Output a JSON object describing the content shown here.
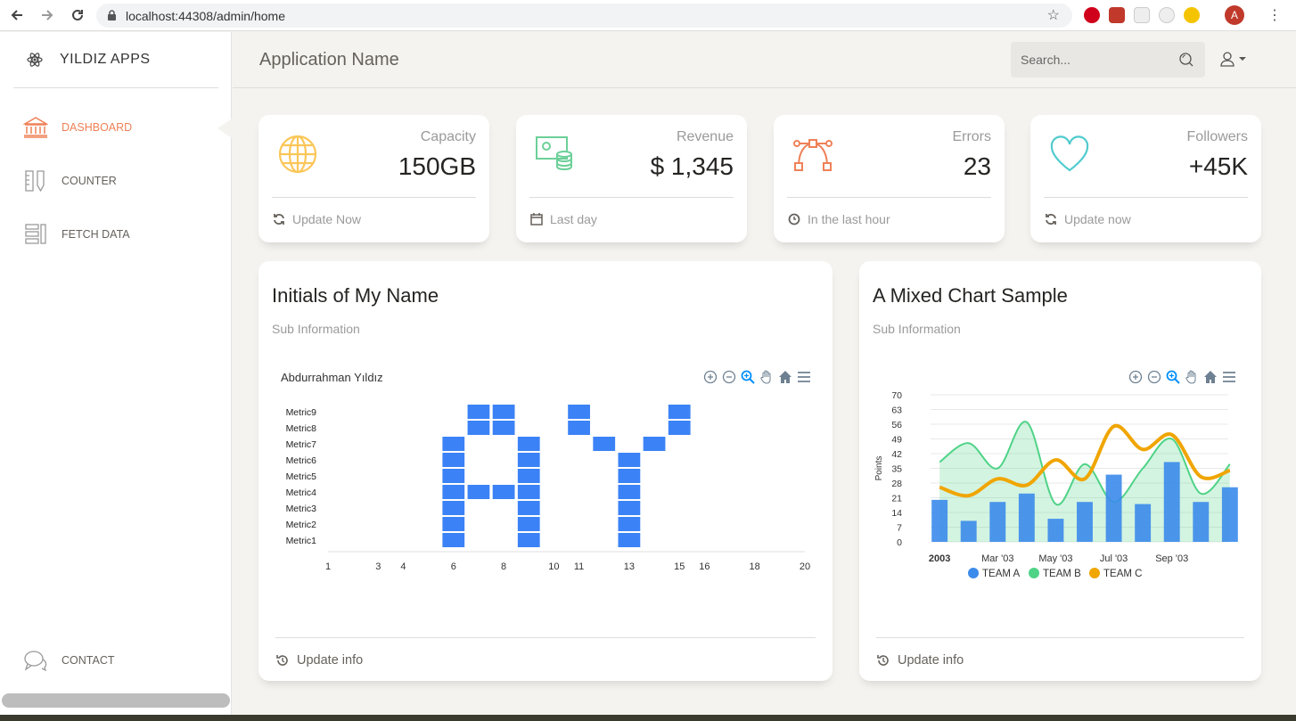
{
  "browser": {
    "url": "localhost:44308/admin/home",
    "avatar_letter": "A"
  },
  "sidebar": {
    "logo_text": "YILDIZ APPS",
    "items": [
      {
        "label": "DASHBOARD",
        "icon": "bank-icon",
        "active": true
      },
      {
        "label": "COUNTER",
        "icon": "ruler-pencil-icon",
        "active": false
      },
      {
        "label": "FETCH DATA",
        "icon": "layout-icon",
        "active": false
      },
      {
        "label": "CONTACT",
        "icon": "chat-icon",
        "active": false
      }
    ]
  },
  "topbar": {
    "app_name": "Application Name",
    "search_placeholder": "Search..."
  },
  "stats": [
    {
      "category": "Capacity",
      "value": "150GB",
      "footer": "Update Now",
      "icon": "globe-icon",
      "color": "#fbc658"
    },
    {
      "category": "Revenue",
      "value": "$ 1,345",
      "footer": "Last day",
      "icon": "money-coins-icon",
      "color": "#6bd098"
    },
    {
      "category": "Errors",
      "value": "23",
      "footer": "In the last hour",
      "icon": "vector-icon",
      "color": "#ef8157"
    },
    {
      "category": "Followers",
      "value": "+45K",
      "footer": "Update now",
      "icon": "heart-icon",
      "color": "#51cbce"
    }
  ],
  "cards": {
    "heatmap": {
      "title": "Initials of My Name",
      "subtitle": "Sub Information",
      "footer": "Update info"
    },
    "mixed": {
      "title": "A Mixed Chart Sample",
      "subtitle": "Sub Information",
      "footer": "Update info"
    }
  },
  "chart_data": [
    {
      "type": "heatmap",
      "title": "Abdurrahman Yıldız",
      "y_categories": [
        "Metric1",
        "Metric2",
        "Metric3",
        "Metric4",
        "Metric5",
        "Metric6",
        "Metric7",
        "Metric8",
        "Metric9"
      ],
      "x_ticks": [
        1,
        3,
        4,
        6,
        8,
        10,
        11,
        13,
        15,
        16,
        18,
        20
      ],
      "xlim": [
        1,
        20
      ],
      "filled_cells": [
        {
          "metric": "Metric9",
          "x": [
            7,
            8,
            11,
            15
          ]
        },
        {
          "metric": "Metric8",
          "x": [
            7,
            8,
            11,
            15
          ]
        },
        {
          "metric": "Metric7",
          "x": [
            6,
            9,
            12,
            14
          ]
        },
        {
          "metric": "Metric6",
          "x": [
            6,
            9,
            13
          ]
        },
        {
          "metric": "Metric5",
          "x": [
            6,
            9,
            13
          ]
        },
        {
          "metric": "Metric4",
          "x": [
            6,
            7,
            8,
            9,
            13
          ]
        },
        {
          "metric": "Metric3",
          "x": [
            6,
            9,
            13
          ]
        },
        {
          "metric": "Metric2",
          "x": [
            6,
            9,
            13
          ]
        },
        {
          "metric": "Metric1",
          "x": [
            6,
            9,
            13
          ]
        }
      ],
      "color": "#3b82f6"
    },
    {
      "type": "mixed",
      "ylabel": "Points",
      "ylim": [
        0,
        70
      ],
      "y_ticks": [
        0,
        7,
        14,
        21,
        28,
        35,
        42,
        49,
        56,
        63,
        70
      ],
      "x_tick_labels": [
        "2003",
        "Mar '03",
        "May '03",
        "Jul '03",
        "Sep '03"
      ],
      "x": [
        "01/01/2003",
        "02/01/2003",
        "03/01/2003",
        "04/01/2003",
        "05/01/2003",
        "06/01/2003",
        "07/01/2003",
        "08/01/2003",
        "09/01/2003",
        "10/01/2003",
        "11/01/2003"
      ],
      "series": [
        {
          "name": "TEAM A",
          "kind": "bar",
          "color": "#3b8beb",
          "values": [
            20,
            10,
            19,
            23,
            11,
            19,
            32,
            18,
            38,
            19,
            26
          ]
        },
        {
          "name": "TEAM B",
          "kind": "area",
          "color": "#4fd387",
          "values": [
            38,
            47,
            35,
            57,
            18,
            37,
            19,
            35,
            49,
            23,
            37
          ]
        },
        {
          "name": "TEAM C",
          "kind": "line",
          "color": "#f0a500",
          "values": [
            26,
            22,
            30,
            27,
            39,
            30,
            55,
            44,
            51,
            31,
            34
          ]
        }
      ],
      "legend": "bottom"
    }
  ]
}
